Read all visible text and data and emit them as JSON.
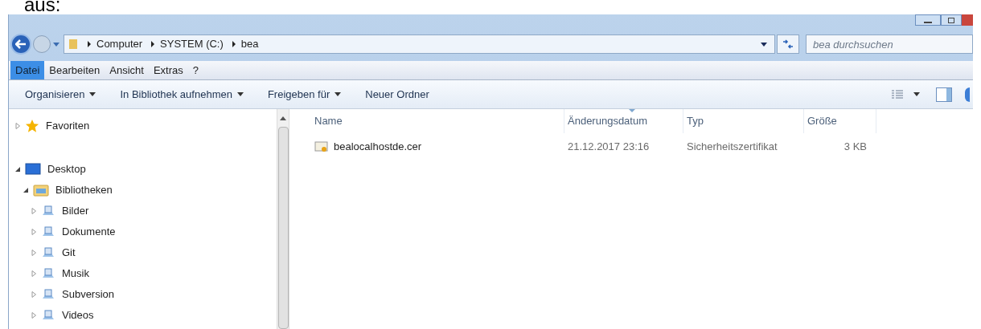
{
  "page_caption": "aus:",
  "address_bar": {
    "breadcrumbs": [
      "Computer",
      "SYSTEM (C:)",
      "bea"
    ]
  },
  "search": {
    "placeholder": "bea durchsuchen"
  },
  "menu": [
    {
      "label": "Datei",
      "selected": true
    },
    {
      "label": "Bearbeiten",
      "selected": false
    },
    {
      "label": "Ansicht",
      "selected": false
    },
    {
      "label": "Extras",
      "selected": false
    },
    {
      "label": "?",
      "selected": false
    }
  ],
  "toolbar": [
    {
      "label": "Organisieren",
      "dropdown": true
    },
    {
      "label": "In Bibliothek aufnehmen",
      "dropdown": true
    },
    {
      "label": "Freigeben für",
      "dropdown": true
    },
    {
      "label": "Neuer Ordner",
      "dropdown": false
    }
  ],
  "sidebar": {
    "items": [
      {
        "label": "Favoriten",
        "expanded": false
      },
      {
        "label": "Desktop",
        "expanded": true,
        "children": [
          {
            "label": "Bibliotheken",
            "expanded": true,
            "children": [
              {
                "label": "Bilder",
                "expanded": false
              },
              {
                "label": "Dokumente",
                "expanded": false
              },
              {
                "label": "Git",
                "expanded": false
              },
              {
                "label": "Musik",
                "expanded": false
              },
              {
                "label": "Subversion",
                "expanded": false
              },
              {
                "label": "Videos",
                "expanded": false
              }
            ]
          }
        ]
      }
    ]
  },
  "table": {
    "columns": [
      {
        "label": "Name",
        "sorted": false
      },
      {
        "label": "Änderungsdatum",
        "sorted": true
      },
      {
        "label": "Typ",
        "sorted": false
      },
      {
        "label": "Größe",
        "sorted": false
      }
    ],
    "rows": [
      [
        "bealocalhostde.cer",
        "21.12.2017 23:16",
        "Sicherheitszertifikat",
        "3 KB"
      ]
    ]
  }
}
